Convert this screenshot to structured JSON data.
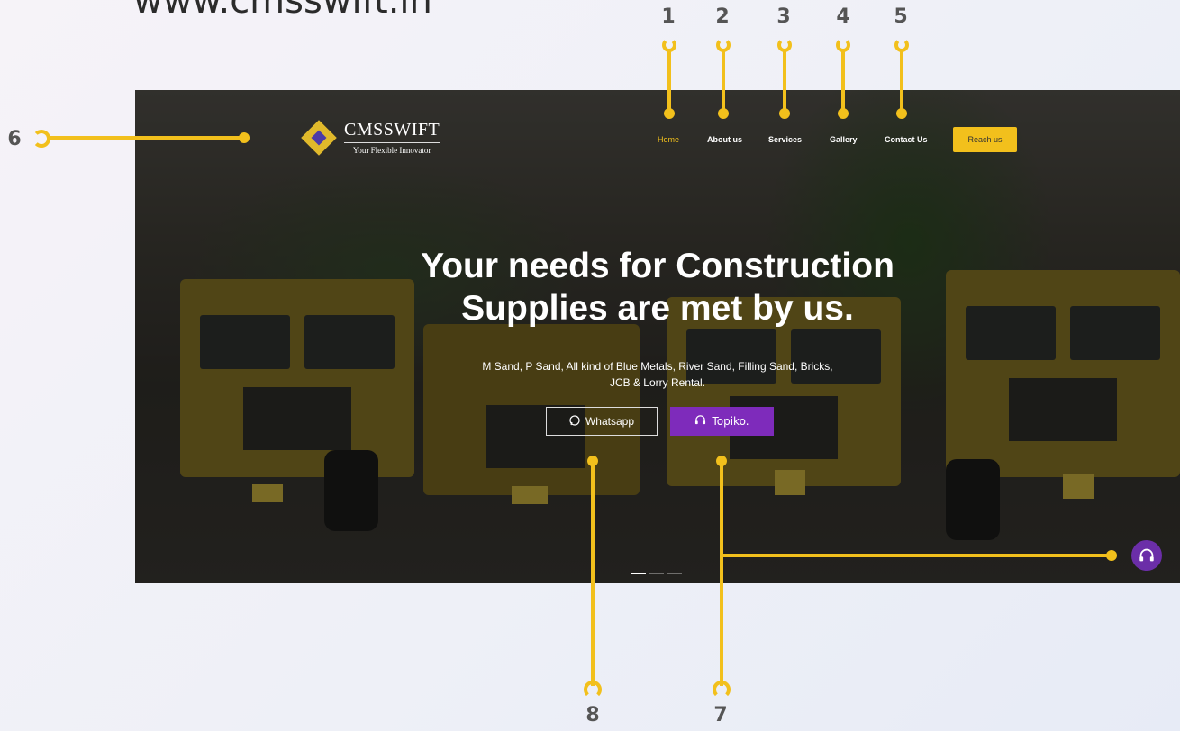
{
  "page": {
    "url_caption": "www.cmsswift.in"
  },
  "callouts": [
    "1",
    "2",
    "3",
    "4",
    "5",
    "6",
    "7",
    "8"
  ],
  "site": {
    "logo_name": "CMSSWIFT",
    "logo_tagline": "Your Flexible Innovator",
    "nav": [
      "Home",
      "About us",
      "Services",
      "Gallery",
      "Contact Us"
    ],
    "reach_label": "Reach us",
    "headline_line1": "Your needs for Construction",
    "headline_line2": "Supplies are met by us.",
    "sub_line1": "M Sand, P Sand, All kind of Blue Metals, River Sand, Filling Sand, Bricks,",
    "sub_line2": "JCB & Lorry Rental.",
    "whatsapp_label": "Whatsapp",
    "topiko_label": "Topiko."
  },
  "icons": {
    "whatsapp": "whatsapp-icon",
    "headset": "headset-icon",
    "support": "headset-icon"
  },
  "slider": {
    "count": 3,
    "active": 1
  },
  "colors": {
    "accent": "#f2c01c",
    "topiko": "#7e2bbb",
    "active_nav": "#f2c01c"
  }
}
